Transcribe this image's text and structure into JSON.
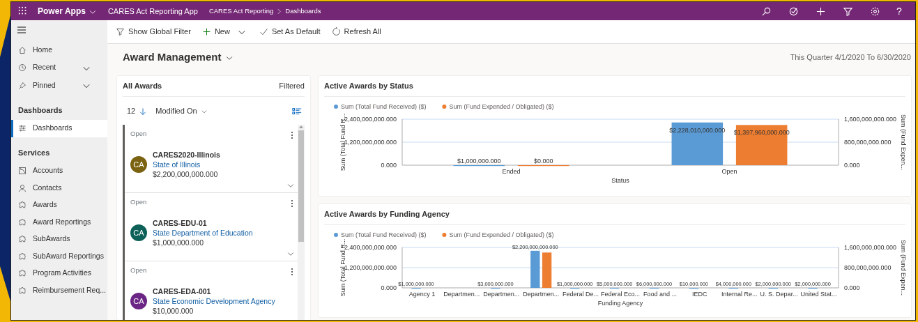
{
  "top_bar": {
    "brand": "Power Apps",
    "app_name": "CARES Act Reporting App",
    "breadcrumb": [
      "CARES Act Reporting",
      "Dashboards"
    ],
    "help": "?"
  },
  "command_bar": [
    {
      "label": "Show Global Filter",
      "kind": "button"
    },
    {
      "label": "New",
      "kind": "split"
    },
    {
      "label": "Set As Default",
      "kind": "button"
    },
    {
      "label": "Refresh All",
      "kind": "button"
    }
  ],
  "sidebar": {
    "top_items": [
      {
        "label": "Home",
        "expandable": false
      },
      {
        "label": "Recent",
        "expandable": true
      },
      {
        "label": "Pinned",
        "expandable": true
      }
    ],
    "sections": [
      {
        "title": "Dashboards",
        "items": [
          {
            "label": "Dashboards",
            "selected": true
          }
        ]
      },
      {
        "title": "Services",
        "items": [
          {
            "label": "Accounts",
            "selected": false
          },
          {
            "label": "Contacts",
            "selected": false
          },
          {
            "label": "Awards",
            "selected": false
          },
          {
            "label": "Award Reportings",
            "selected": false
          },
          {
            "label": "SubAwards",
            "selected": false
          },
          {
            "label": "SubAward Reportings",
            "selected": false
          },
          {
            "label": "Program Activities",
            "selected": false
          },
          {
            "label": "Reimbursement Req..."
          }
        ]
      }
    ]
  },
  "dashboard": {
    "title": "Award Management",
    "period": "This Quarter 4/1/2020 To 6/30/2020",
    "list": {
      "title": "All Awards",
      "filter_status": "Filtered",
      "count": "12",
      "sort": "Modified On",
      "records": [
        {
          "status": "Open",
          "initials": "CA",
          "color": "#7a6210",
          "name": "CARES2020-Illinois",
          "account": "State of Illinois",
          "amount": "$2,200,000,000.000"
        },
        {
          "status": "Open",
          "initials": "CA",
          "color": "#0e6158",
          "name": "CARES-EDU-01",
          "account": "State Department of Education",
          "amount": "$1,000,000.000"
        },
        {
          "status": "Open",
          "initials": "CA",
          "color": "#6b2685",
          "name": "CARES-EDA-001",
          "account": "State Economic Development Agency",
          "amount": "$10,000.000"
        }
      ]
    },
    "charts": [
      {
        "title": "Active Awards by Status",
        "chart_data": {
          "type": "bar",
          "legend": "top",
          "ref_lines": [
            {
              "axis": "y",
              "value": 1200000000
            }
          ],
          "xlabel": "Status",
          "ylabel": "Sum (Total Fund R...",
          "y2label": "Sum (Fund Expen...",
          "categories": [
            "Ended",
            "Open"
          ],
          "series": [
            {
              "name": "Sum (Total Fund Received) ($)",
              "color": "#5b9bd5",
              "values": [
                1000000,
                2228010000
              ],
              "value_labels": [
                "$1,000,000.000",
                "$2,228,010,000.000"
              ]
            },
            {
              "name": "Sum (Fund Expended / Obligated) ($)",
              "color": "#ed7d31",
              "axis": "y2",
              "values": [
                0,
                1397960000
              ],
              "value_labels": [
                "$0.000",
                "$1,397,960,000.000"
              ]
            }
          ],
          "ylim": [
            0,
            2400000000
          ],
          "yticks": [
            {
              "value": 0,
              "label": "0.000"
            },
            {
              "value": 1200000000,
              "label": "1,200,000,000.000"
            },
            {
              "value": 2400000000,
              "label": "2,400,000,000.000"
            }
          ],
          "y2lim": [
            0,
            1600000000
          ],
          "y2ticks": [
            {
              "value": 0,
              "label": "0.000"
            },
            {
              "value": 800000000,
              "label": "800,000,000.000"
            },
            {
              "value": 1600000000,
              "label": "1,600,000,000.000"
            }
          ]
        }
      },
      {
        "title": "Active Awards by Funding Agency",
        "chart_data": {
          "type": "bar",
          "legend": "top",
          "ref_lines": [
            {
              "axis": "y",
              "value": 1200000000
            }
          ],
          "xlabel": "Funding Agency",
          "ylabel": "Sum (Total Fund R...",
          "y2label": "Sum (Fund Expen...",
          "categories": [
            "Agency 1",
            "Departmen...",
            "Departmen...",
            "Departmen...",
            "Federal De...",
            "Federal Eco...",
            "Food and ...",
            "IEDC",
            "Internal Re...",
            "U. S. Depar...",
            "United Stat..."
          ],
          "series": [
            {
              "name": "Sum (Total Fund Received) ($)",
              "color": "#5b9bd5",
              "values": [
                1000000,
                null,
                3000000,
                2200000000,
                1000000,
                5000000,
                6000000,
                10000,
                4000000,
                2000000,
                2000000
              ],
              "value_labels": [
                "$1,000,000.000",
                null,
                "$3,000,000.000",
                "$2,200,000,000.000",
                "$1,000,000.000",
                "$5,000,000.000",
                "$6,000,000.000",
                "$10,000.000",
                "$4,000,000.000",
                "$2,000,000.000",
                "$2,000,000.000"
              ]
            },
            {
              "name": "Sum (Fund Expended / Obligated) ($)",
              "color": "#ed7d31",
              "axis": "y2",
              "values": [
                null,
                null,
                null,
                1397960000,
                null,
                null,
                null,
                null,
                null,
                null,
                null
              ]
            }
          ],
          "ylim": [
            0,
            2400000000
          ],
          "yticks": [
            {
              "value": 0,
              "label": "0.000"
            },
            {
              "value": 1200000000,
              "label": "1,200,000,000.000"
            },
            {
              "value": 2400000000,
              "label": "2,400,000,000.000"
            }
          ],
          "y2lim": [
            0,
            1600000000
          ],
          "y2ticks": [
            {
              "value": 0,
              "label": "0.000"
            },
            {
              "value": 800000000,
              "label": "800,000,000.000"
            },
            {
              "value": 1600000000,
              "label": "1,600,000,000.000"
            }
          ]
        }
      }
    ]
  }
}
